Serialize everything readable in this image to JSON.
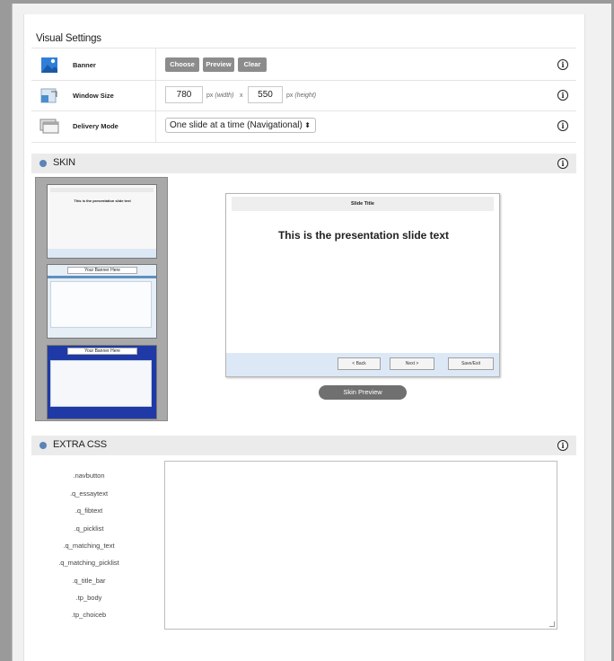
{
  "section_title": "Visual Settings",
  "rows": {
    "banner": {
      "label": "Banner",
      "buttons": [
        "Choose",
        "Preview",
        "Clear"
      ]
    },
    "window_size": {
      "label": "Window Size",
      "width": "780",
      "width_unit": "px",
      "width_hint": "(width)",
      "times": "x",
      "height": "550",
      "height_unit": "px",
      "height_hint": "(height)"
    },
    "delivery_mode": {
      "label": "Delivery Mode",
      "value": "One slide at a time (Navigational)"
    }
  },
  "skin": {
    "label": "SKIN",
    "thumbs": [
      {
        "banner": "",
        "text": "This is the presentation slide text"
      },
      {
        "banner": "Your Banner Here"
      },
      {
        "banner": "Your Banner Here"
      }
    ],
    "preview": {
      "title": "Slide Title",
      "text": "This is the presentation slide text",
      "buttons": [
        "< Back",
        "Next >",
        "Save/Exit"
      ]
    },
    "preview_button": "Skin Preview"
  },
  "extra_css": {
    "label": "EXTRA CSS",
    "classes": [
      ".navbutton",
      ".q_essaytext",
      ".q_fibtext",
      ".q_picklist",
      ".q_matching_text",
      ".q_matching_picklist",
      ".q_title_bar",
      ".tp_body",
      ".tp_choiceb"
    ],
    "value": ""
  },
  "info_symbol": "i",
  "colors": {
    "bar": "#ebebeb",
    "button": "#8c8c8c",
    "accent": "#5b84b8",
    "footer": "#dce8f6"
  }
}
